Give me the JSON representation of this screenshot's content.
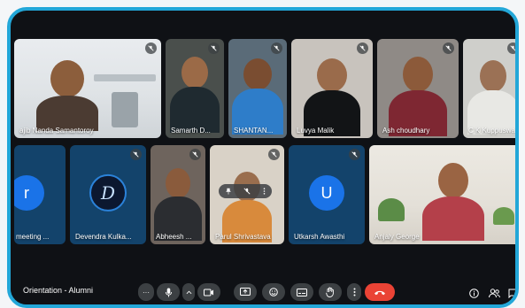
{
  "meeting": {
    "title": "Orientation - Alumni"
  },
  "participants": [
    {
      "name": "ajib Nanda Samantoroy"
    },
    {
      "name": "Samarth D..."
    },
    {
      "name": "SHANTAN..."
    },
    {
      "name": "Luvya Malik"
    },
    {
      "name": "Ash choudhary"
    },
    {
      "name": "C K Kuppuswa..."
    },
    {
      "name": "meeting ...",
      "initial": "r"
    },
    {
      "name": "Devendra Kulka...",
      "initial": "D"
    },
    {
      "name": "Abheesh ..."
    },
    {
      "name": "Parul Shrivastava"
    },
    {
      "name": "Utkarsh Awasthi",
      "initial": "U"
    },
    {
      "name": "Anjaly George"
    }
  ],
  "controls": {
    "more_label": "···",
    "participants_count": "12"
  },
  "colors": {
    "frame_border": "#23a7d8",
    "hangup": "#ea4335",
    "avatar_blue": "#1a73e8"
  },
  "icons": [
    "mic-off-icon",
    "mic-icon",
    "camera-icon",
    "present-icon",
    "emoji-icon",
    "captions-icon",
    "raise-hand-icon",
    "more-icon",
    "hangup-icon",
    "info-icon",
    "people-icon",
    "chat-icon",
    "pin-icon"
  ]
}
